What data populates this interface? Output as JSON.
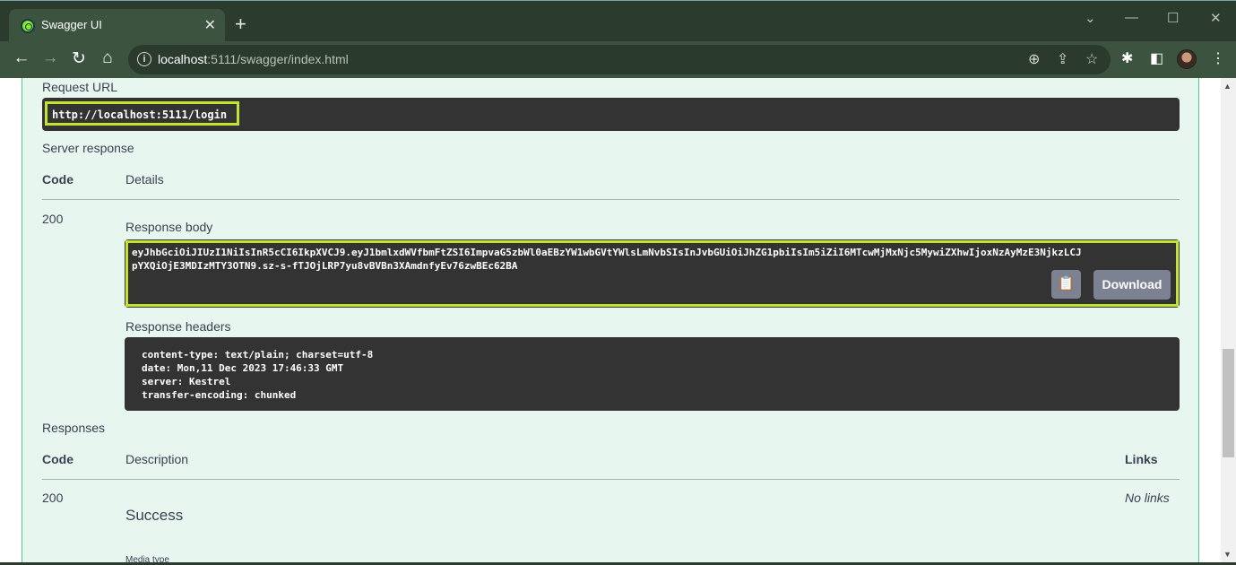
{
  "browser": {
    "tab_title": "Swagger UI",
    "tab_close": "✕",
    "new_tab": "+",
    "url_host": "localhost",
    "url_rest": ":5111/swagger/index.html",
    "icons": [
      "back-arrow-icon",
      "forward-arrow-icon",
      "reload-icon",
      "home-icon",
      "info-icon",
      "zoom-icon",
      "share-icon",
      "star-icon",
      "extensions-icon",
      "side-panel-icon",
      "menu-icon"
    ]
  },
  "request_url": {
    "label": "Request URL",
    "value": "http://localhost:5111/login"
  },
  "server_response": {
    "label": "Server response",
    "code_header": "Code",
    "details_header": "Details",
    "code": "200",
    "body_label": "Response body",
    "body_line1": "eyJhbGciOiJIUzI1NiIsInR5cCI6IkpXVCJ9.eyJ1bmlxdWVfbmFtZSI6ImpvaG5zbWl0aEBzYW1wbGVtYWlsLmNvbSIsInJvbGUiOiJhZG1pbiIsIm5iZiI6MTcwMjMxNjc5MywiZXhwIjoxNzAyMzE3NjkzLCJ",
    "body_line2": "pYXQiOjE3MDIzMTY3OTN9.sz-s-fTJOjLRP7yu8vBVBn3XAmdnfyEv76zwBEc62BA",
    "download_label": "Download",
    "headers_label": "Response headers",
    "headers": [
      "content-type: text/plain; charset=utf-8",
      "date: Mon,11 Dec 2023 17:46:33 GMT",
      "server: Kestrel",
      "transfer-encoding: chunked"
    ]
  },
  "responses": {
    "label": "Responses",
    "code_header": "Code",
    "description_header": "Description",
    "links_header": "Links",
    "code": "200",
    "description": "Success",
    "links": "No links",
    "media_type_label": "Media type"
  },
  "colors": {
    "highlight": "#c2e332",
    "block_bg": "#e8f6f0",
    "block_border": "#49cc90"
  }
}
